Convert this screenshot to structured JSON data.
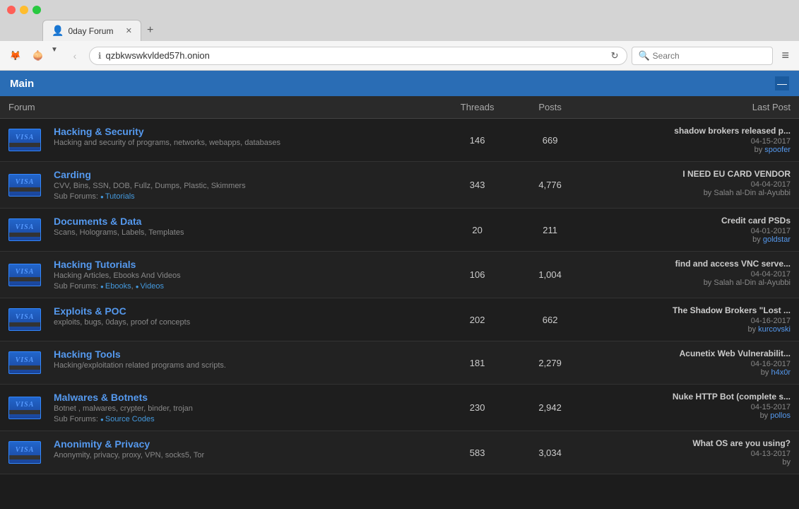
{
  "browser": {
    "tab_title": "0day Forum",
    "url": "qzbkwswkvlded57h.onion",
    "search_placeholder": "Search",
    "new_tab_label": "+",
    "back_btn": "‹",
    "forward_btn": "›",
    "menu_btn": "≡"
  },
  "main": {
    "title": "Main",
    "collapse_btn": "—",
    "table_headers": {
      "forum": "Forum",
      "threads": "Threads",
      "posts": "Posts",
      "last_post": "Last Post"
    },
    "forums": [
      {
        "name": "Hacking & Security",
        "desc": "Hacking and security of programs, networks, webapps, databases",
        "subforums": [],
        "threads": "146",
        "posts": "669",
        "last_title": "shadow brokers released p...",
        "last_date": "04-15-2017",
        "last_by": "by",
        "last_user": "spoofer"
      },
      {
        "name": "Carding",
        "desc": "CVV, Bins, SSN, DOB, Fullz, Dumps, Plastic, Skimmers",
        "subforums": [
          "Tutorials"
        ],
        "threads": "343",
        "posts": "4,776",
        "last_title": "I NEED EU CARD VENDOR",
        "last_date": "04-04-2017",
        "last_by": "by Salah al-Din al-Ayubbi",
        "last_user": ""
      },
      {
        "name": "Documents & Data",
        "desc": "Scans, Holograms, Labels, Templates",
        "subforums": [],
        "threads": "20",
        "posts": "211",
        "last_title": "Credit card PSDs",
        "last_date": "04-01-2017",
        "last_by": "by",
        "last_user": "goldstar"
      },
      {
        "name": "Hacking Tutorials",
        "desc": "Hacking Articles, Ebooks And Videos",
        "subforums": [
          "Ebooks",
          "Videos"
        ],
        "threads": "106",
        "posts": "1,004",
        "last_title": "find and access VNC serve...",
        "last_date": "04-04-2017",
        "last_by": "by Salah al-Din al-Ayubbi",
        "last_user": ""
      },
      {
        "name": "Exploits & POC",
        "desc": "exploits, bugs, 0days, proof of concepts",
        "subforums": [],
        "threads": "202",
        "posts": "662",
        "last_title": "The Shadow Brokers \"Lost ...",
        "last_date": "04-16-2017",
        "last_by": "by",
        "last_user": "kurcovski"
      },
      {
        "name": "Hacking Tools",
        "desc": "Hacking/exploitation related programs and scripts.",
        "subforums": [],
        "threads": "181",
        "posts": "2,279",
        "last_title": "Acunetix Web Vulnerabilit...",
        "last_date": "04-16-2017",
        "last_by": "by",
        "last_user": "h4x0r"
      },
      {
        "name": "Malwares & Botnets",
        "desc": "Botnet , malwares, crypter, binder, trojan",
        "subforums": [
          "Source Codes"
        ],
        "threads": "230",
        "posts": "2,942",
        "last_title": "Nuke HTTP Bot (complete s...",
        "last_date": "04-15-2017",
        "last_by": "by",
        "last_user": "pollos"
      },
      {
        "name": "Anonimity & Privacy",
        "desc": "Anonymity, privacy, proxy, VPN, socks5, Tor",
        "subforums": [],
        "threads": "583",
        "posts": "3,034",
        "last_title": "What OS are you using?",
        "last_date": "04-13-2017",
        "last_by": "by",
        "last_user": ""
      }
    ]
  }
}
